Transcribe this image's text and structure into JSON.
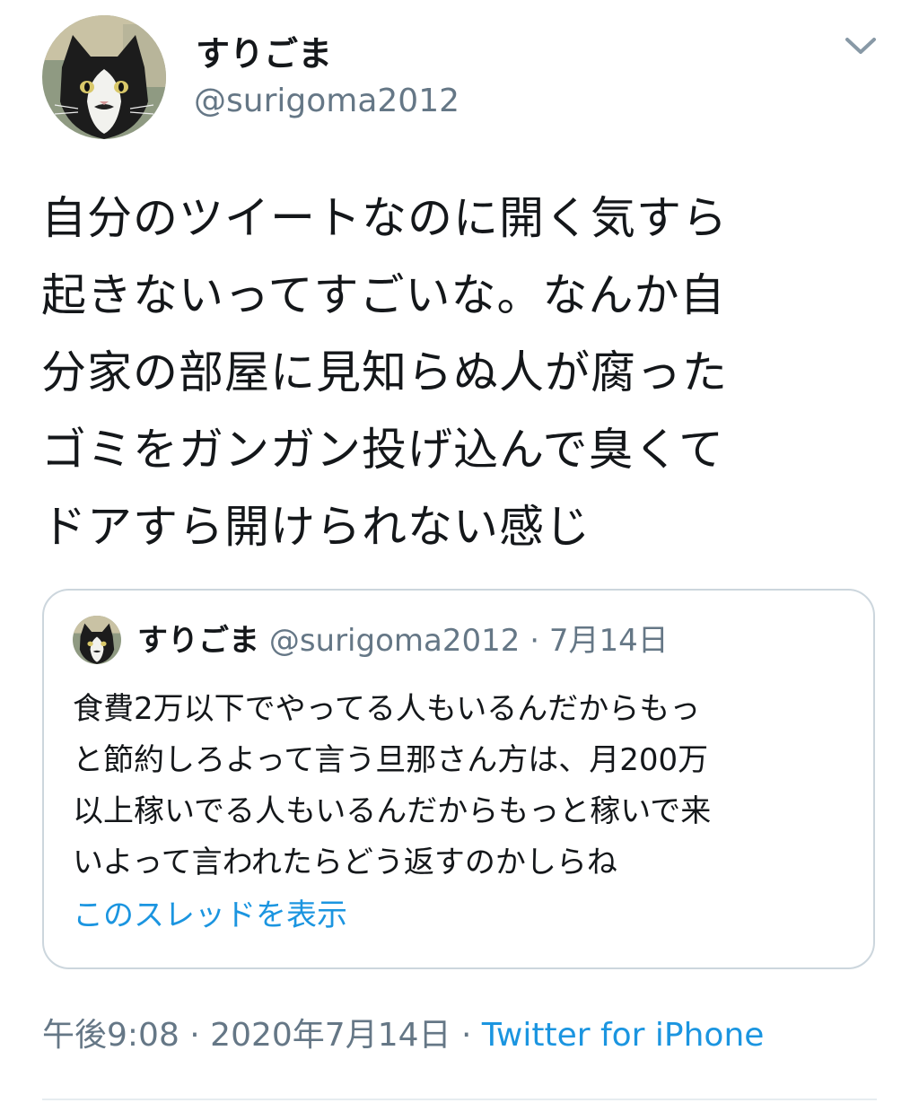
{
  "author": {
    "display_name": "すりごま",
    "handle": "@surigoma2012",
    "avatar_icon": "cat-avatar-icon"
  },
  "tweet": {
    "text_lines": [
      "自分のツイートなのに開く気すら",
      "起きないってすごいな。なんか自",
      "分家の部屋に見知らぬ人が腐った",
      "ゴミをガンガン投げ込んで臭くて",
      "ドアすら開けられない感じ"
    ],
    "timestamp": "午後9:08 · 2020年7月14日",
    "meta_separator": " · ",
    "source": "Twitter for iPhone"
  },
  "quoted_tweet": {
    "display_name": "すりごま",
    "handle": "@surigoma2012",
    "separator": "·",
    "date": "7月14日",
    "text_lines": [
      "食費2万以下でやってる人もいるんだからもっ",
      "と節約しろよって言う旦那さん方は、月200万",
      "以上稼いでる人もいるんだからもっと稼いで来",
      "いよって言われたらどう返すのかしらね"
    ],
    "thread_link": "このスレッドを表示"
  },
  "colors": {
    "text": "#14171a",
    "secondary": "#657786",
    "link": "#1b95e0",
    "border": "#ccd6dd"
  }
}
